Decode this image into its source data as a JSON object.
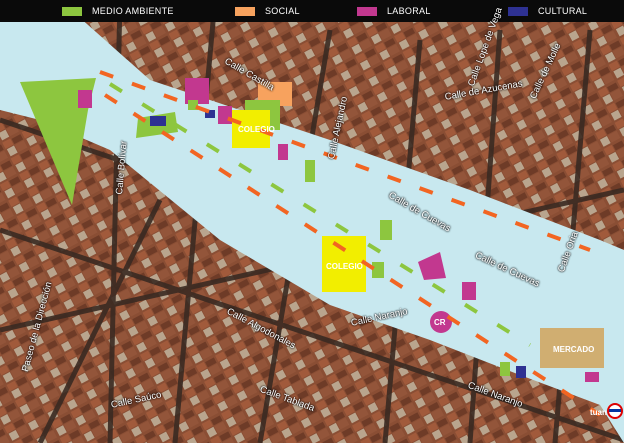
{
  "legend": [
    {
      "label": "MEDIO AMBIENTE",
      "color": "#8dc63f"
    },
    {
      "label": "SOCIAL",
      "color": "#f7a25e"
    },
    {
      "label": "LABORAL",
      "color": "#c2388f"
    },
    {
      "label": "CULTURAL",
      "color": "#2e3192"
    }
  ],
  "colors": {
    "boulevard": "#c8e8ef",
    "school": "#f2ee00",
    "market": "#d1a35a",
    "dash": "#f26522"
  },
  "map_labels": {
    "colegio_1": "COLEGIO",
    "colegio_2": "COLEGIO",
    "cr_1": "CR",
    "cr_2": "CR",
    "mercado": "MERCADO",
    "metro": "tuan"
  },
  "streets": [
    "Calle Castilla",
    "Calle Lope de Vega",
    "Calle de Azucenas",
    "Calle de Molle",
    "Calle Castilla",
    "Calle Topete",
    "Calle Bolívar",
    "Calle Pedro Tezano",
    "Calle Alejandro",
    "Calle de Bravo Murillo",
    "Calle Juan Pantoja",
    "Calle Infanta Mercedes",
    "Calle de Cuevas",
    "Calle Rosario",
    "Calle Algodonales",
    "Calle Naranjo",
    "Calle Tablada",
    "Calle Saúco",
    "Calle Alvarado",
    "Calle Naranjo",
    "Paseo de la Dirección",
    "Calle Palencia",
    "Calle Almansa",
    "Calle Oria",
    "Calle Marqués de Viana"
  ]
}
